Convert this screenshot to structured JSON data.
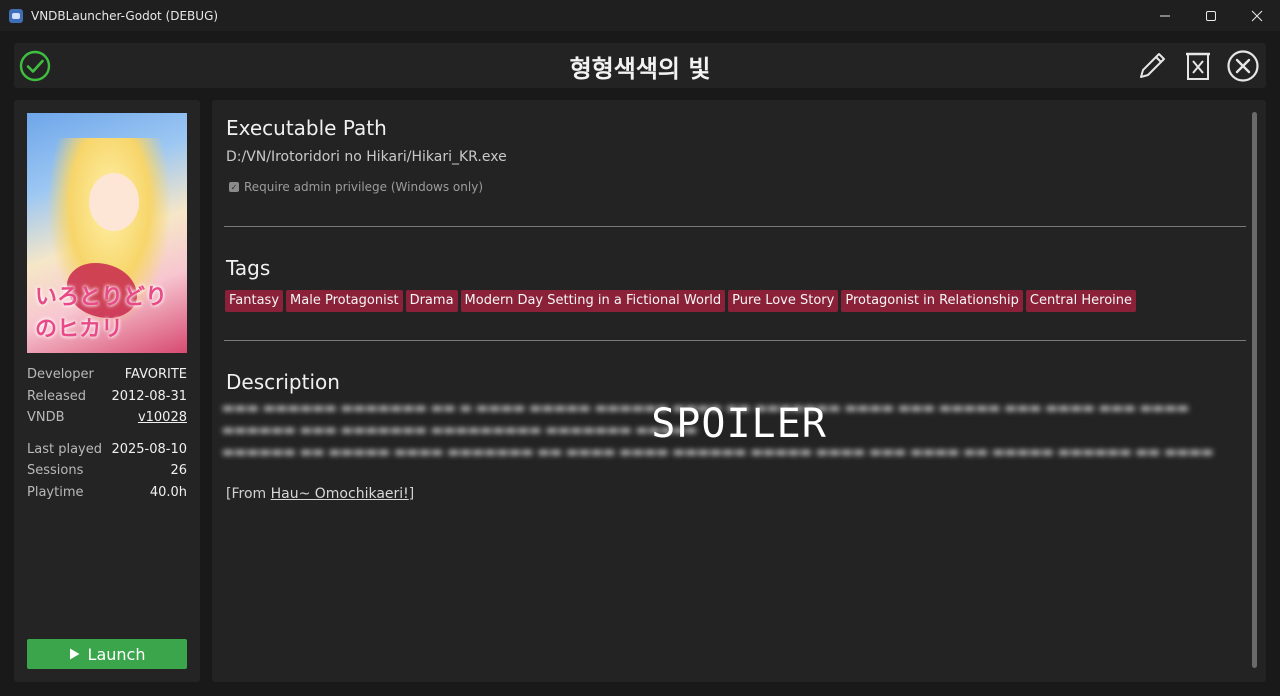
{
  "window": {
    "title": "VNDBLauncher-Godot (DEBUG)",
    "icon": "godot-icon"
  },
  "header": {
    "game_title": "형형색색의 빛",
    "status_icon": "check-circle-icon",
    "edit_icon": "pencil-icon",
    "delete_icon": "delete-file-icon",
    "close_icon": "close-circle-icon"
  },
  "sidebar": {
    "info": [
      {
        "label": "Developer",
        "value": "FAVORITE"
      },
      {
        "label": "Released",
        "value": "2012-08-31"
      },
      {
        "label": "VNDB",
        "value": "v10028"
      }
    ],
    "stats": [
      {
        "label": "Last played",
        "value": "2025-08-10"
      },
      {
        "label": "Sessions",
        "value": "26"
      },
      {
        "label": "Playtime",
        "value": "40.0h"
      }
    ],
    "cover_logo": "いろとりどりのヒカリ",
    "launch_label": "Launch"
  },
  "main": {
    "exe_title": "Executable Path",
    "exe_path": "D:/VN/Irotoridori no Hikari/Hikari_KR.exe",
    "admin_label": "Require admin privilege (Windows only)",
    "admin_checked": true,
    "tags_title": "Tags",
    "tags": [
      "Fantasy",
      "Male Protagonist",
      "Drama",
      "Modern Day Setting in a Fictional World",
      "Pure Love Story",
      "Protagonist in Relationship",
      "Central Heroine"
    ],
    "description_title": "Description",
    "spoiler_label": "SPOILER",
    "source_prefix": "[From ",
    "source_link": "Hau~ Omochikaeri!",
    "source_suffix": "]"
  },
  "colors": {
    "tag_bg": "#8a2139",
    "launch_bg": "#3aa54a",
    "status_green": "#3fbf3f"
  }
}
